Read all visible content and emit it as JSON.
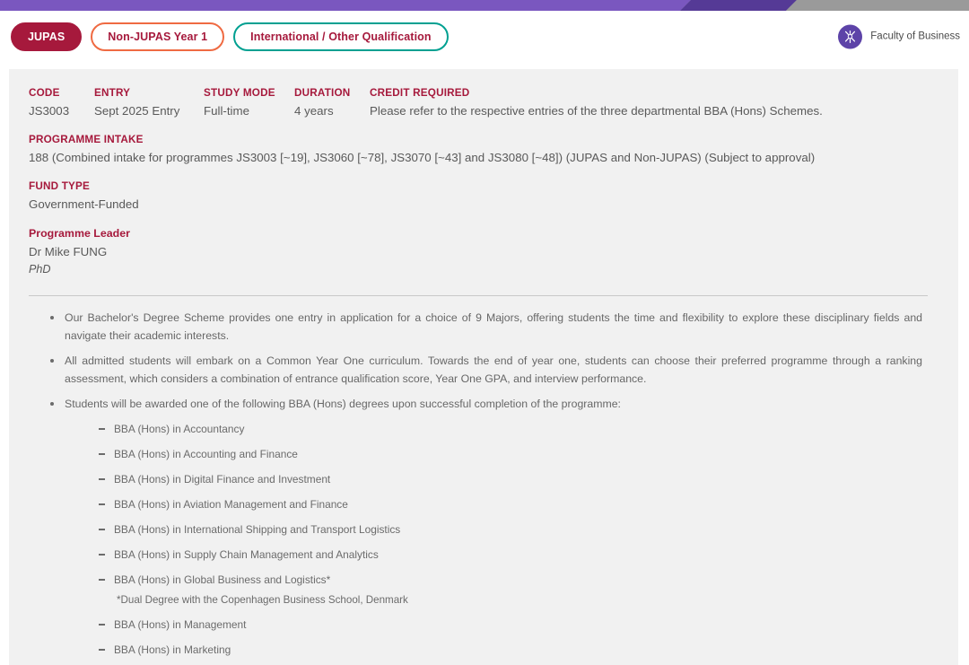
{
  "topbar": {
    "colors": {
      "light_purple": "#7a57bf",
      "dark_purple": "#553a96",
      "gray": "#9a9a9a"
    }
  },
  "tabs": [
    {
      "label": "JUPAS",
      "state": "active",
      "accent": "#a6193c"
    },
    {
      "label": "Non-JUPAS Year 1",
      "state": "inactive",
      "accent": "#ef6a42"
    },
    {
      "label": "International / Other Qualification",
      "state": "inactive",
      "accent": "#00a091"
    }
  ],
  "faculty": {
    "icon": "faculty-crest-icon",
    "label": "Faculty of Business",
    "badge_color": "#5d43a8"
  },
  "facts": {
    "code": {
      "label": "CODE",
      "value": "JS3003"
    },
    "entry": {
      "label": "ENTRY",
      "value": "Sept 2025 Entry"
    },
    "study_mode": {
      "label": "STUDY MODE",
      "value": "Full-time"
    },
    "duration": {
      "label": "DURATION",
      "value": "4 years"
    },
    "credit_required": {
      "label": "CREDIT REQUIRED",
      "value": "Please refer to the respective entries of the three departmental BBA (Hons) Schemes."
    },
    "programme_intake": {
      "label": "PROGRAMME INTAKE",
      "value": "188 (Combined intake for programmes JS3003 [~19], JS3060 [~78], JS3070 [~43] and JS3080 [~48]) (JUPAS and Non-JUPAS) (Subject to approval)"
    },
    "fund_type": {
      "label": "FUND TYPE",
      "value": "Government-Funded"
    },
    "programme_leader": {
      "label": "Programme Leader",
      "name": "Dr Mike FUNG",
      "degree": "PhD"
    }
  },
  "bullets": [
    "Our Bachelor's Degree Scheme provides one entry in application for a choice of 9 Majors, offering students the time and flexibility to explore these disciplinary fields and navigate their academic interests.",
    "All admitted students will embark on a Common Year One curriculum. Towards the end of year one, students can choose their preferred programme through a ranking assessment, which considers a combination of entrance qualification score, Year One GPA, and interview performance.",
    "Students will be awarded one of the following BBA (Hons) degrees upon successful completion of the programme:"
  ],
  "degrees": [
    {
      "name": "BBA (Hons) in Accountancy"
    },
    {
      "name": "BBA (Hons) in Accounting and Finance"
    },
    {
      "name": "BBA (Hons) in Digital Finance and Investment"
    },
    {
      "name": "BBA (Hons) in Aviation Management and Finance"
    },
    {
      "name": "BBA (Hons) in International Shipping and Transport Logistics"
    },
    {
      "name": "BBA (Hons) in Supply Chain Management and Analytics"
    },
    {
      "name": "BBA (Hons) in Global Business and Logistics*",
      "note": "*Dual Degree with the Copenhagen Business School, Denmark"
    },
    {
      "name": "BBA (Hons) in Management"
    },
    {
      "name": "BBA (Hons) in Marketing"
    }
  ]
}
